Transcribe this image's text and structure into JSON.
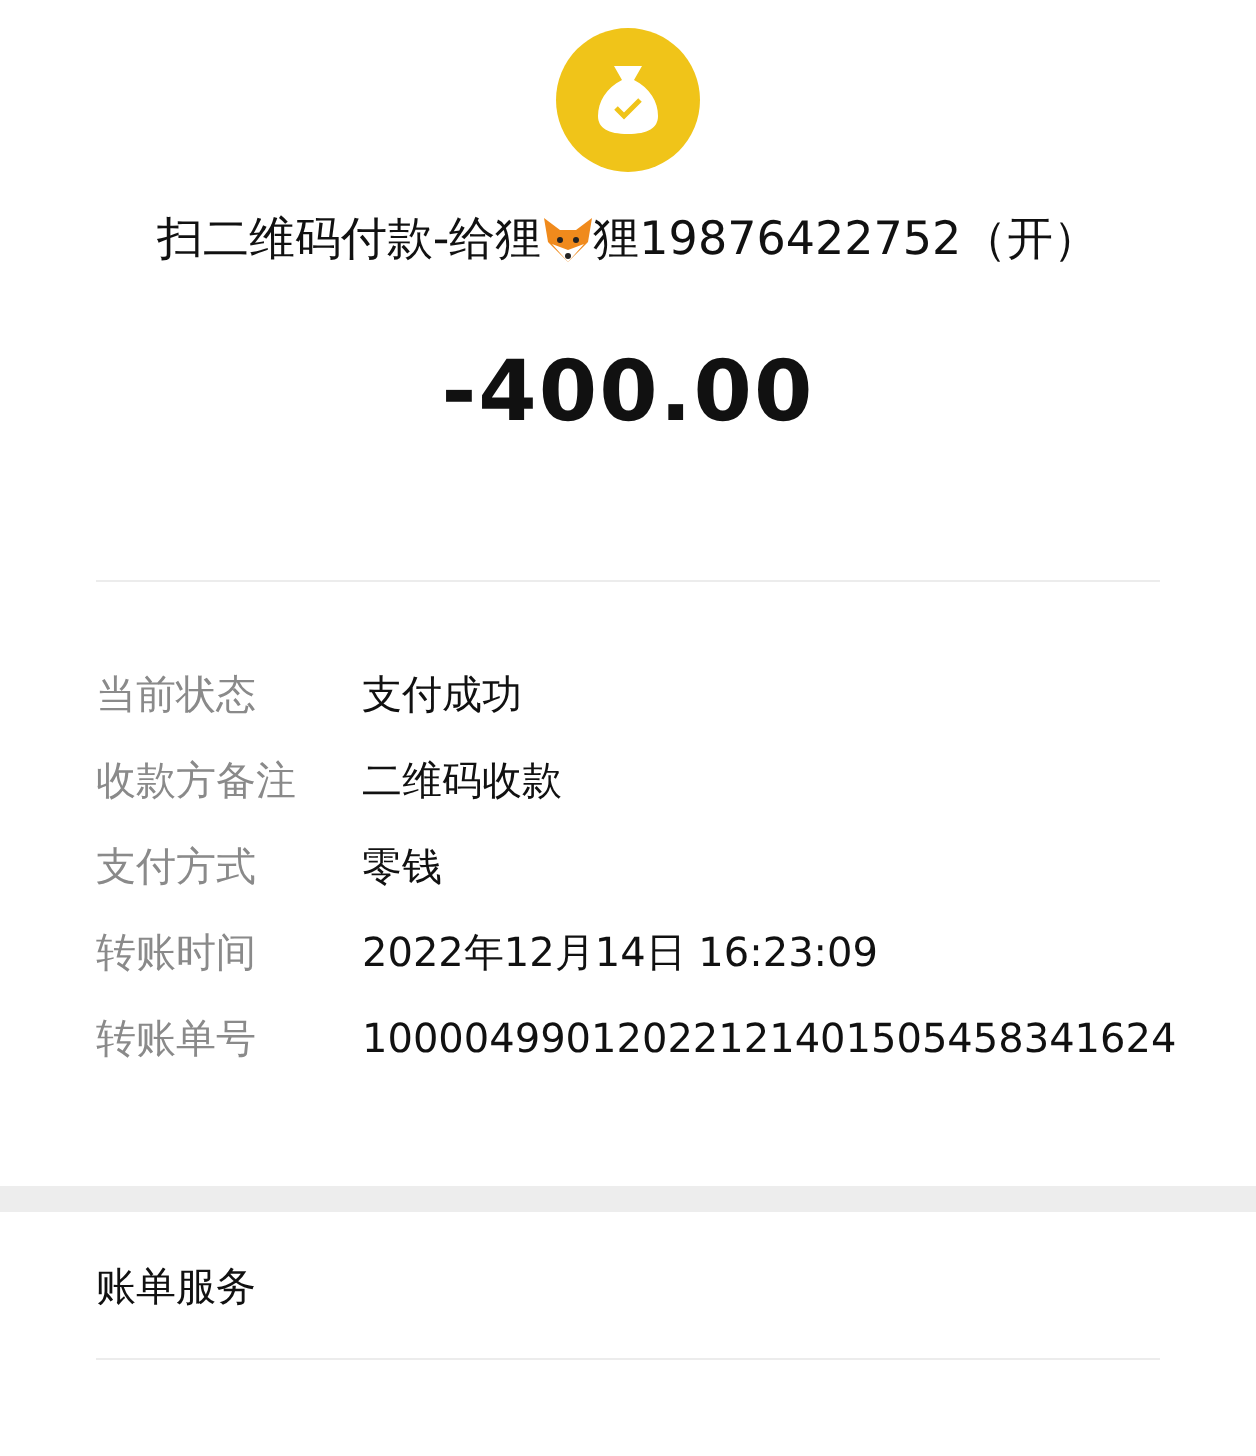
{
  "header": {
    "title_before": "扫二维码付款-给狸",
    "title_after": "狸19876422752（开）",
    "amount": "-400.00"
  },
  "details": [
    {
      "label": "当前状态",
      "value": "支付成功"
    },
    {
      "label": "收款方备注",
      "value": "二维码收款"
    },
    {
      "label": "支付方式",
      "value": "零钱"
    },
    {
      "label": "转账时间",
      "value": "2022年12月14日 16:23:09"
    },
    {
      "label": "转账单号",
      "value": "10000499012022121401505458341624"
    }
  ],
  "services": {
    "label": "账单服务"
  }
}
